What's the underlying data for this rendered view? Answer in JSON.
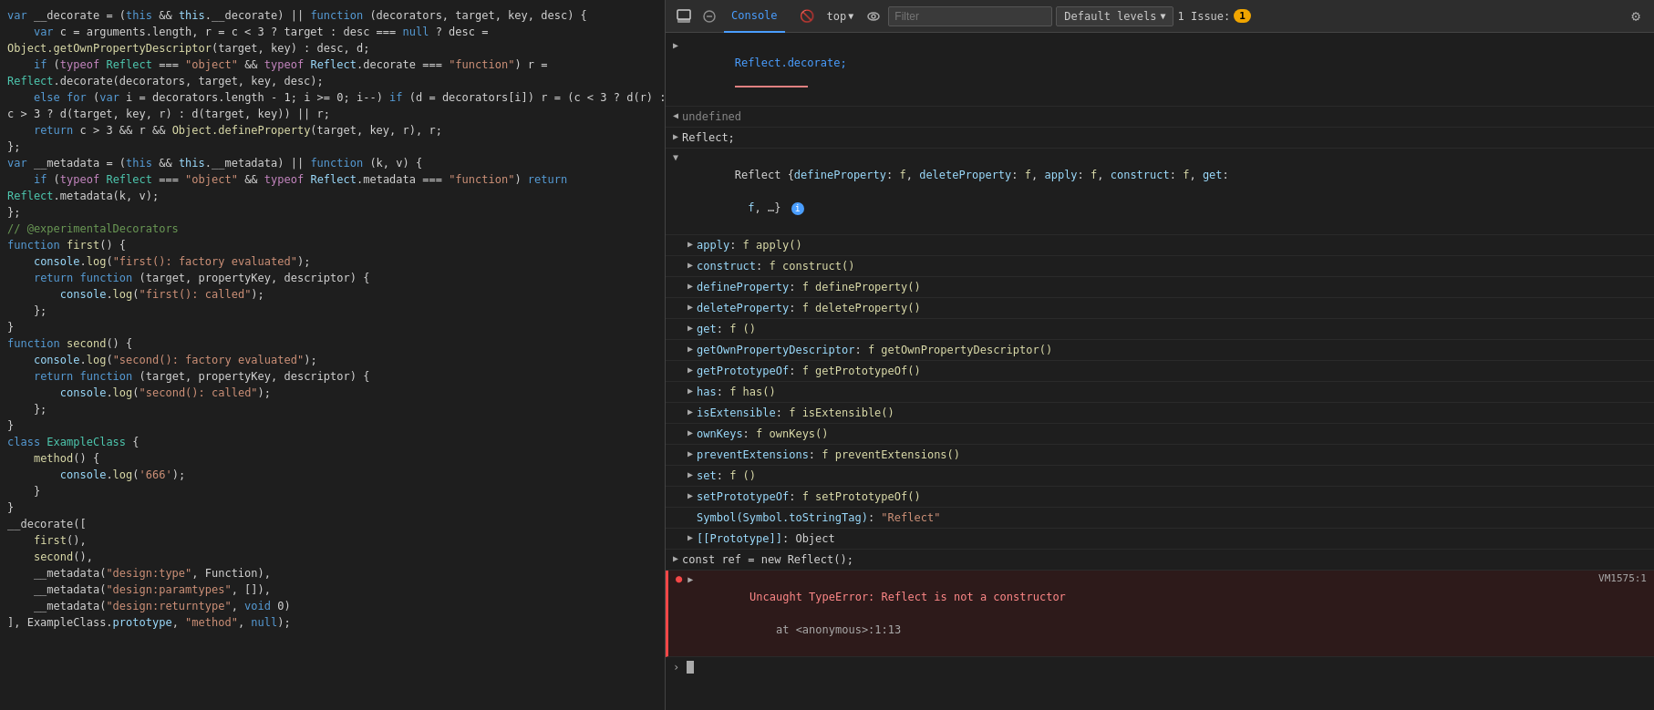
{
  "code_panel": {
    "lines": [
      {
        "id": 1,
        "content": "var __decorate = (this && this.__decorate) || function (decorators, target, key, desc) {"
      },
      {
        "id": 2,
        "content": "    var c = arguments.length, r = c < 3 ? target : desc === null ? desc ="
      },
      {
        "id": 3,
        "content": "Object.getOwnPropertyDescriptor(target, key) : desc, d;"
      },
      {
        "id": 4,
        "content": "    if (typeof Reflect === \"object\" && typeof Reflect.decorate === \"function\") r ="
      },
      {
        "id": 5,
        "content": "Reflect.decorate(decorators, target, key, desc);"
      },
      {
        "id": 6,
        "content": "    else for (var i = decorators.length - 1; i >= 0; i--) if (d = decorators[i]) r = (c < 3 ? d(r) :"
      },
      {
        "id": 7,
        "content": "c > 3 ? d(target, key, r) : d(target, key)) || r;"
      },
      {
        "id": 8,
        "content": "    return c > 3 && r && Object.defineProperty(target, key, r), r;"
      },
      {
        "id": 9,
        "content": "};"
      },
      {
        "id": 10,
        "content": "var __metadata = (this && this.__metadata) || function (k, v) {"
      },
      {
        "id": 11,
        "content": "    if (typeof Reflect === \"object\" && typeof Reflect.metadata === \"function\") return"
      },
      {
        "id": 12,
        "content": "Reflect.metadata(k, v);"
      },
      {
        "id": 13,
        "content": "};"
      },
      {
        "id": 14,
        "content": "// @experimentalDecorators"
      },
      {
        "id": 15,
        "content": "function first() {"
      },
      {
        "id": 16,
        "content": "    console.log(\"first(): factory evaluated\");"
      },
      {
        "id": 17,
        "content": "    return function (target, propertyKey, descriptor) {"
      },
      {
        "id": 18,
        "content": "        console.log(\"first(): called\");"
      },
      {
        "id": 19,
        "content": "    };"
      },
      {
        "id": 20,
        "content": "}"
      },
      {
        "id": 21,
        "content": "function second() {"
      },
      {
        "id": 22,
        "content": "    console.log(\"second(): factory evaluated\");"
      },
      {
        "id": 23,
        "content": "    return function (target, propertyKey, descriptor) {"
      },
      {
        "id": 24,
        "content": "        console.log(\"second(): called\");"
      },
      {
        "id": 25,
        "content": "    };"
      },
      {
        "id": 26,
        "content": "}"
      },
      {
        "id": 27,
        "content": "class ExampleClass {"
      },
      {
        "id": 28,
        "content": "    method() {"
      },
      {
        "id": 29,
        "content": "        console.log('666');"
      },
      {
        "id": 30,
        "content": "    }"
      },
      {
        "id": 31,
        "content": "}"
      },
      {
        "id": 32,
        "content": "__decorate(["
      },
      {
        "id": 33,
        "content": "    first(),"
      },
      {
        "id": 34,
        "content": "    second(),"
      },
      {
        "id": 35,
        "content": "    __metadata(\"design:type\", Function),"
      },
      {
        "id": 36,
        "content": "    __metadata(\"design:paramtypes\", []),"
      },
      {
        "id": 37,
        "content": "    __metadata(\"design:returntype\", void 0)"
      },
      {
        "id": 38,
        "content": "], ExampleClass.prototype, \"method\", null);"
      }
    ]
  },
  "devtools": {
    "tab_label": "Console",
    "top_label": "top",
    "filter_placeholder": "Filter",
    "default_levels_label": "Default levels",
    "chevron": "▼",
    "issues_label": "1 Issue:",
    "issues_count": "1",
    "console_rows": [
      {
        "type": "expandable",
        "arrow": "▶",
        "text": "Reflect.decorate;",
        "is_link": true,
        "indent": 0
      },
      {
        "type": "plain",
        "arrow": "◀",
        "text": "undefined",
        "color": "gray",
        "indent": 0
      },
      {
        "type": "expandable",
        "arrow": "▶",
        "text": "Reflect;",
        "indent": 0
      },
      {
        "type": "expandable",
        "arrow": "▶",
        "text": "Reflect {defineProperty: f, deleteProperty: f, apply: f, construct: f, get:",
        "text2": "f, …}",
        "has_badge": true,
        "indent": 0
      },
      {
        "type": "expandable",
        "arrow": "▶",
        "text": "apply: f apply()",
        "indent": 1
      },
      {
        "type": "expandable",
        "arrow": "▶",
        "text": "construct: f construct()",
        "indent": 1
      },
      {
        "type": "expandable",
        "arrow": "▶",
        "text": "defineProperty: f defineProperty()",
        "indent": 1
      },
      {
        "type": "expandable",
        "arrow": "▶",
        "text": "deleteProperty: f deleteProperty()",
        "indent": 1
      },
      {
        "type": "expandable",
        "arrow": "▶",
        "text": "get: f ()",
        "indent": 1
      },
      {
        "type": "expandable",
        "arrow": "▶",
        "text": "getOwnPropertyDescriptor: f getOwnPropertyDescriptor()",
        "indent": 1
      },
      {
        "type": "expandable",
        "arrow": "▶",
        "text": "getPrototypeOf: f getPrototypeOf()",
        "indent": 1
      },
      {
        "type": "expandable",
        "arrow": "▶",
        "text": "has: f has()",
        "indent": 1
      },
      {
        "type": "expandable",
        "arrow": "▶",
        "text": "isExtensible: f isExtensible()",
        "indent": 1
      },
      {
        "type": "expandable",
        "arrow": "▶",
        "text": "ownKeys: f ownKeys()",
        "indent": 1
      },
      {
        "type": "expandable",
        "arrow": "▶",
        "text": "preventExtensions: f preventExtensions()",
        "indent": 1
      },
      {
        "type": "expandable",
        "arrow": "▶",
        "text": "set: f ()",
        "indent": 1
      },
      {
        "type": "expandable",
        "arrow": "▶",
        "text": "setPrototypeOf: f setPrototypeOf()",
        "indent": 1
      },
      {
        "type": "plain",
        "arrow": "▶",
        "text": "Symbol(Symbol.toStringTag): \"Reflect\"",
        "indent": 1
      },
      {
        "type": "plain",
        "arrow": "▶",
        "text": "[[Prototype]]: Object",
        "indent": 1
      },
      {
        "type": "expandable",
        "arrow": "▶",
        "text": "const ref = new Reflect();",
        "indent": 0
      },
      {
        "type": "error",
        "icon": "●",
        "arrow": "▶",
        "text": "Uncaught TypeError: Reflect is not a constructor",
        "subtext": "    at <anonymous>:1:13",
        "vm_link": "VM1575:1",
        "indent": 0
      }
    ],
    "prompt_arrow": ">"
  }
}
